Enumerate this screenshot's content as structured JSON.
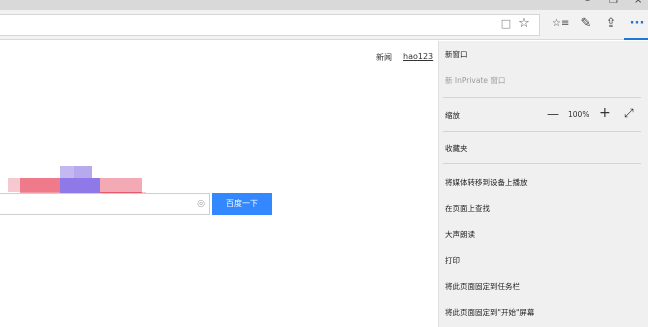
{
  "window": {
    "min_icon": "minimize-icon",
    "max_icon": "maximize-icon",
    "close_icon": "close-icon",
    "min_glyph": "–",
    "max_glyph": "❐",
    "close_glyph": "×"
  },
  "toolbar": {
    "reading_glyph": "□",
    "fav_glyph": "☆",
    "hub_glyph": "☆≡",
    "note_glyph": "✎",
    "share_glyph": "⇪",
    "more_glyph": "···",
    "accent_color": "#1e78d7"
  },
  "page": {
    "links": {
      "news": "新闻",
      "hao": "hao123"
    },
    "search_button": "百度一下",
    "search_value": "",
    "camera_glyph": "◎"
  },
  "menu": {
    "new_window": "新窗口",
    "new_inprivate": "新 InPrivate 窗口",
    "zoom_label": "缩放",
    "zoom_minus": "—",
    "zoom_value": "100%",
    "zoom_plus": "+",
    "zoom_fullscreen": "⤢",
    "favorites": "收藏夹",
    "cast": "将媒体转移到设备上播放",
    "find_on_page": "在页面上查找",
    "read_aloud": "大声朗读",
    "print": "打印",
    "pin_taskbar": "将此页面固定到任务栏",
    "pin_start": "将此页面固定到\"开始\"屏幕"
  }
}
